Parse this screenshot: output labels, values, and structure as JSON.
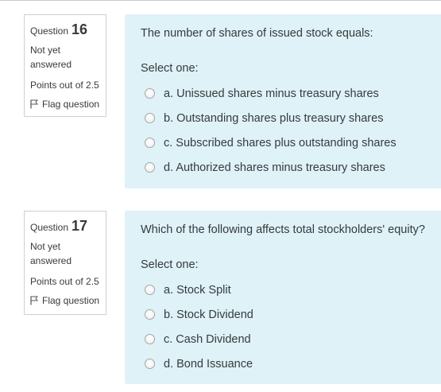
{
  "questions": [
    {
      "label": "Question",
      "number": "16",
      "state": "Not yet answered",
      "grade": "Points out of 2.5",
      "flag_label": "Flag question",
      "text": "The number of shares of issued stock equals:",
      "prompt": "Select one:",
      "answers": [
        "a. Unissued shares minus treasury shares",
        "b. Outstanding shares plus treasury shares",
        "c. Subscribed shares plus outstanding shares",
        "d. Authorized shares minus treasury shares"
      ]
    },
    {
      "label": "Question",
      "number": "17",
      "state": "Not yet answered",
      "grade": "Points out of 2.5",
      "flag_label": "Flag question",
      "text": "Which of the following affects total stockholders' equity?",
      "prompt": "Select one:",
      "answers": [
        "a. Stock Split",
        "b. Stock Dividend",
        "c. Cash Dividend",
        "d. Bond Issuance"
      ]
    }
  ],
  "colors": {
    "content_background": "#def2f8",
    "info_border": "#cecfd1",
    "text": "#373a3c"
  },
  "icons": {
    "flag": "flag-icon",
    "radio": "radio-unchecked"
  }
}
